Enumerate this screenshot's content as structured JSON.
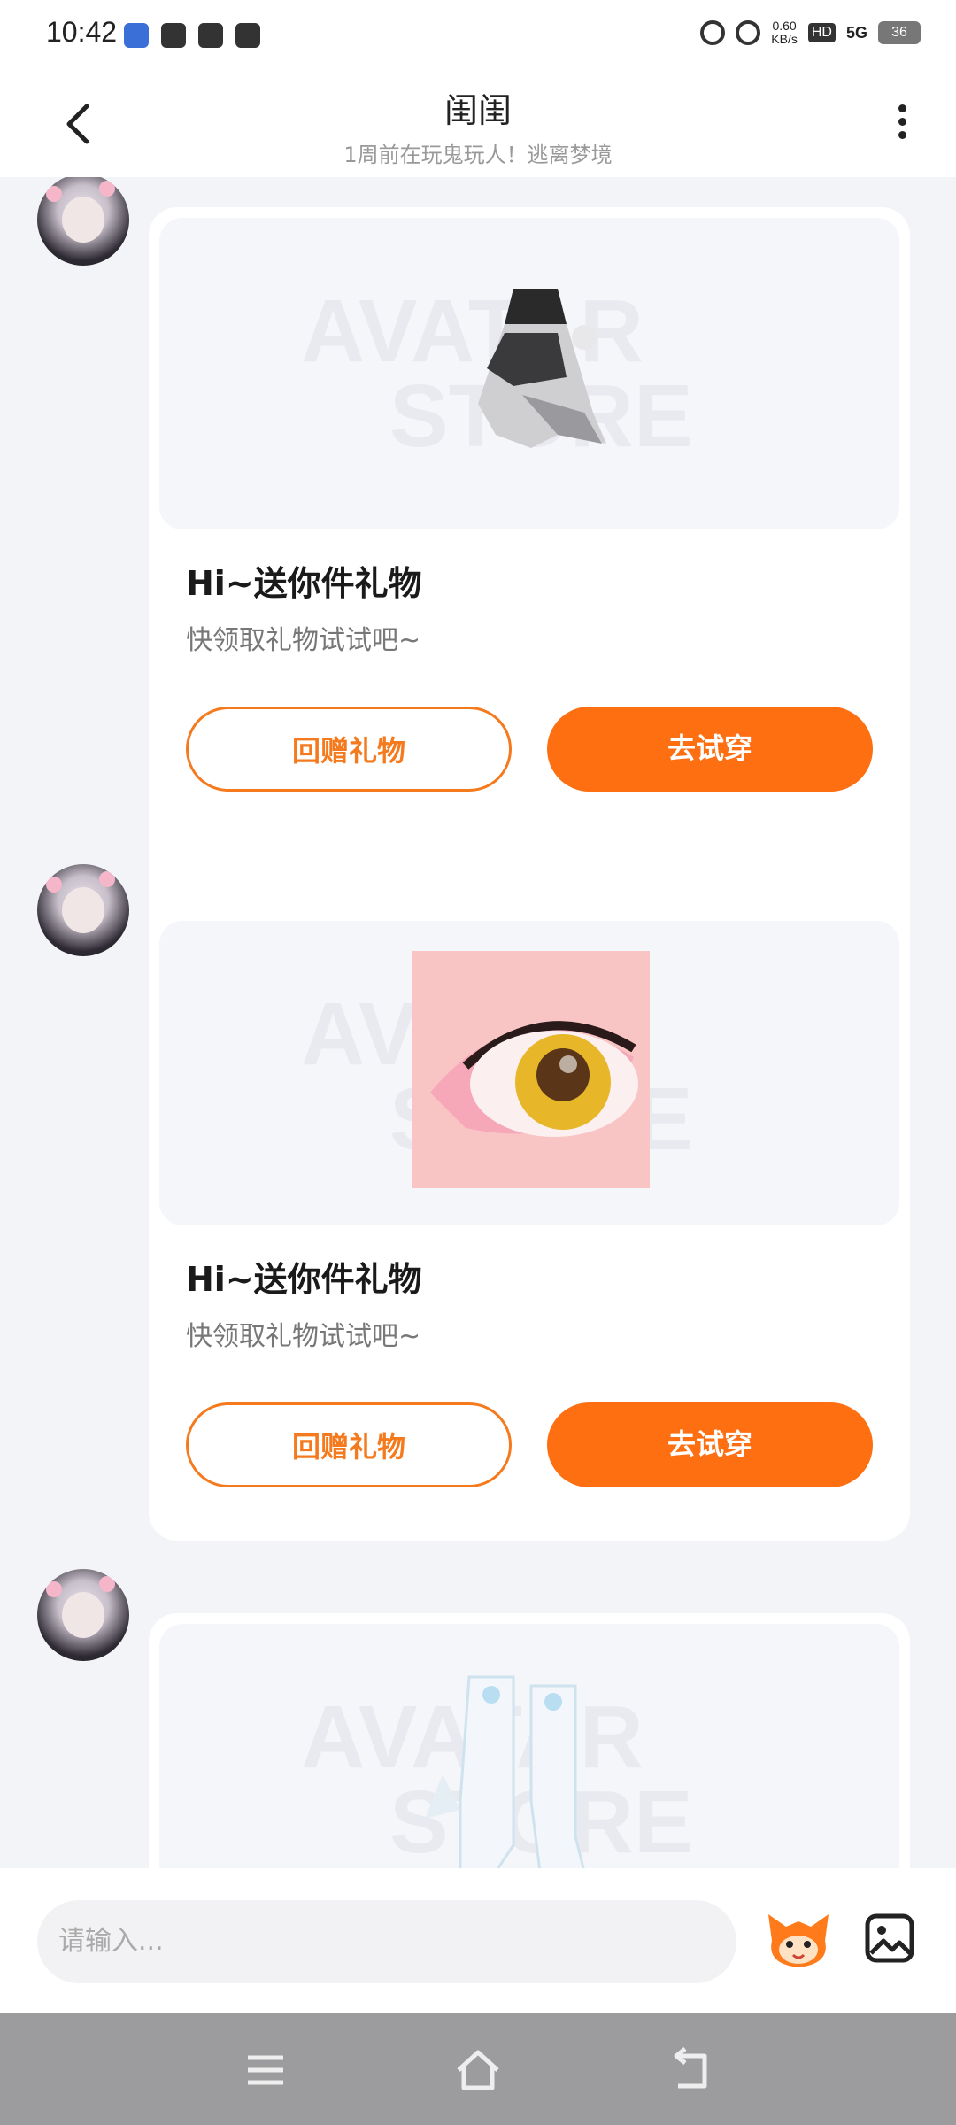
{
  "status_bar": {
    "time": "10:42",
    "net_speed_value": "0.60",
    "net_speed_unit": "KB/s",
    "hd": "HD",
    "signal": "5G",
    "battery": "36"
  },
  "header": {
    "title": "闺闺",
    "subtitle": "1周前在玩鬼玩人！逃离梦境",
    "back_icon": "chevron-left-icon",
    "more_icon": "more-vertical-icon"
  },
  "messages": [
    {
      "item": "black-white-dress",
      "title": "Hi~送你件礼物",
      "subtitle": "快领取礼物试试吧~",
      "return_gift_label": "回赠礼物",
      "try_on_label": "去试穿"
    },
    {
      "item": "pink-eye-makeup",
      "title": "Hi~送你件礼物",
      "subtitle": "快领取礼物试试吧~",
      "return_gift_label": "回赠礼物",
      "try_on_label": "去试穿"
    },
    {
      "item": "white-boots",
      "title": "",
      "subtitle": "",
      "return_gift_label": "",
      "try_on_label": ""
    }
  ],
  "watermark": {
    "line1": "AVATAR",
    "line2": "STORE"
  },
  "input_bar": {
    "placeholder": "请输入...",
    "mascot_icon": "fox-mascot-icon",
    "image_icon": "image-icon"
  },
  "colors": {
    "accent": "#fd6f11",
    "outline": "#f57a1e",
    "background": "#f3f4f8"
  }
}
